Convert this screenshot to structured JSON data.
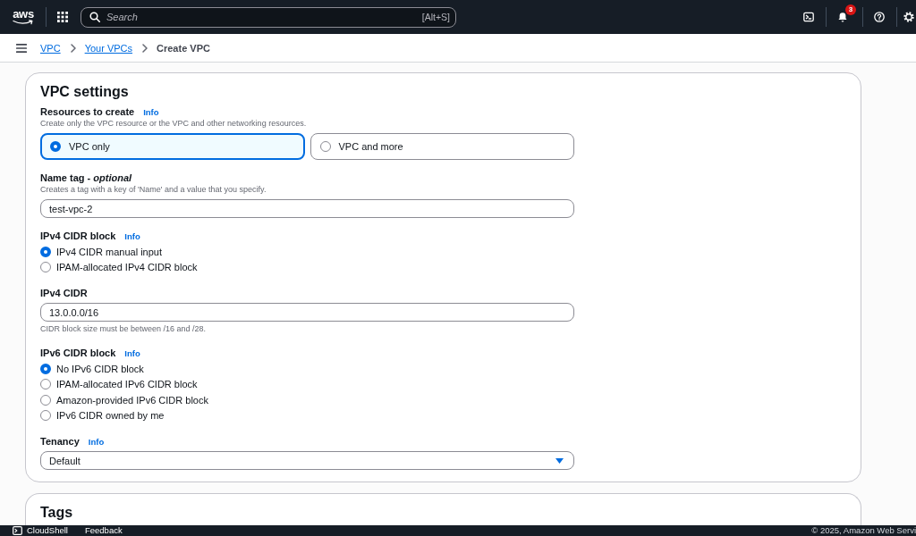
{
  "top_bar": {
    "logo": "aws",
    "search": {
      "placeholder": "Search",
      "shortcut": "[Alt+S]"
    },
    "notification_count": "3"
  },
  "breadcrumbs": [
    {
      "label": "VPC",
      "current": false
    },
    {
      "label": "Your VPCs",
      "current": false
    },
    {
      "label": "Create VPC",
      "current": true
    }
  ],
  "vpc_settings": {
    "title": "VPC settings",
    "sections": [
      {
        "kind": "tiles",
        "label": "Resources to create",
        "info": "Info",
        "description": "Create only the VPC resource or the VPC and other networking resources.",
        "options": [
          {
            "label": "VPC only",
            "selected": true
          },
          {
            "label": "VPC and more",
            "selected": false
          }
        ]
      },
      {
        "kind": "text_input",
        "label": "Name tag - *optional*",
        "description": "Creates a tag with a key of 'Name' and a value that you specify.",
        "value": "test-vpc-2"
      },
      {
        "kind": "radio_group",
        "label": "IPv4 CIDR block",
        "info": "Info",
        "options": [
          {
            "label": "IPv4 CIDR manual input",
            "selected": true
          },
          {
            "label": "IPAM-allocated IPv4 CIDR block",
            "selected": false
          }
        ]
      },
      {
        "kind": "text_input",
        "label": "IPv4 CIDR",
        "value": "13.0.0.0/16",
        "hint": "CIDR block size must be between /16 and /28."
      },
      {
        "kind": "radio_group",
        "label": "IPv6 CIDR block",
        "info": "Info",
        "options": [
          {
            "label": "No IPv6 CIDR block",
            "selected": true
          },
          {
            "label": "IPAM-allocated IPv6 CIDR block",
            "selected": false
          },
          {
            "label": "Amazon-provided IPv6 CIDR block",
            "selected": false
          },
          {
            "label": "IPv6 CIDR owned by me",
            "selected": false
          }
        ]
      },
      {
        "kind": "select",
        "label": "Tenancy",
        "info": "Info",
        "value": "Default"
      }
    ]
  },
  "tags": {
    "title": "Tags"
  },
  "footer": {
    "cloudshell": "CloudShell",
    "feedback": "Feedback",
    "copyright": "© 2025, Amazon Web Servi"
  }
}
